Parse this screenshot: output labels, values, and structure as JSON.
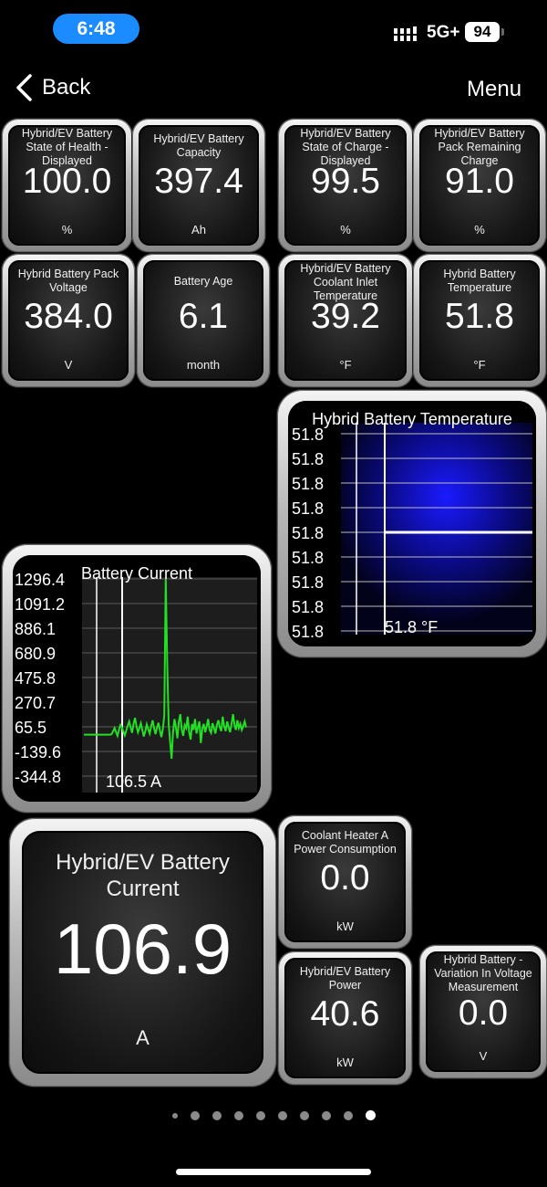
{
  "status_bar": {
    "time": "6:48",
    "network": "5G+",
    "battery": "94"
  },
  "nav": {
    "back_label": "Back",
    "menu_label": "Menu"
  },
  "gauges": [
    {
      "title": "Hybrid/EV Battery State of Health - Displayed",
      "value": "100.0",
      "unit": "%"
    },
    {
      "title": "Hybrid/EV Battery Capacity",
      "value": "397.4",
      "unit": "Ah"
    },
    {
      "title": "Hybrid/EV Battery State of Charge - Displayed",
      "value": "99.5",
      "unit": "%"
    },
    {
      "title": "Hybrid/EV Battery Pack Remaining Charge",
      "value": "91.0",
      "unit": "%"
    },
    {
      "title": "Hybrid Battery Pack Voltage",
      "value": "384.0",
      "unit": "V"
    },
    {
      "title": "Battery Age",
      "value": "6.1",
      "unit": "month"
    },
    {
      "title": "Hybrid/EV Battery Coolant Inlet Temperature",
      "value": "39.2",
      "unit": "°F"
    },
    {
      "title": "Hybrid Battery Temperature",
      "value": "51.8",
      "unit": "°F"
    },
    {
      "title": "Coolant Heater A Power Consumption",
      "value": "0.0",
      "unit": "kW"
    },
    {
      "title": "Hybrid/EV Battery Power",
      "value": "40.6",
      "unit": "kW"
    },
    {
      "title": "Hybrid Battery - Variation In Voltage Measurement",
      "value": "0.0",
      "unit": "V"
    }
  ],
  "big_gauge": {
    "title": "Hybrid/EV Battery Current",
    "value": "106.9",
    "unit": "A"
  },
  "temp_graph": {
    "title": "Hybrid Battery Temperature",
    "readout": "51.8 °F",
    "y_ticks": [
      "51.8",
      "51.8",
      "51.8",
      "51.8",
      "51.8",
      "51.8",
      "51.8",
      "51.8",
      "51.8"
    ]
  },
  "current_graph": {
    "title": "Battery Current",
    "readout": "106.5 A",
    "y_ticks": [
      "1296.4",
      "1091.2",
      "886.1",
      "680.9",
      "475.8",
      "270.7",
      "65.5",
      "-139.6",
      "-344.8"
    ]
  },
  "chart_data": [
    {
      "type": "line",
      "title": "Hybrid Battery Temperature",
      "series": [
        {
          "name": "Hybrid Battery Temperature",
          "values": [
            51.8,
            51.8,
            51.8,
            51.8,
            51.8,
            51.8,
            51.8,
            51.8
          ]
        }
      ],
      "unit": "°F",
      "color": "#ffffff"
    },
    {
      "type": "line",
      "title": "Battery Current",
      "ylim": [
        -344.8,
        1296.4
      ],
      "unit": "A",
      "color": "#22e022",
      "series": [
        {
          "name": "Battery Current",
          "values": [
            0,
            0,
            0,
            0,
            0,
            0,
            0,
            0,
            0,
            0,
            0,
            0,
            0,
            0,
            0,
            0,
            0,
            0,
            0,
            5,
            30,
            55,
            20,
            -10,
            40,
            80,
            60,
            25,
            -5,
            35,
            75,
            110,
            60,
            15,
            90,
            140,
            70,
            20,
            55,
            95,
            40,
            -15,
            30,
            85,
            45,
            10,
            70,
            120,
            55,
            5,
            60,
            100,
            35,
            -20,
            45,
            160,
            1296,
            600,
            90,
            -60,
            -200,
            20,
            130,
            60,
            -30,
            110,
            170,
            40,
            -10,
            80,
            55,
            150,
            20,
            -40,
            90,
            40,
            130,
            10,
            60,
            110,
            -70,
            50,
            90,
            20,
            70,
            130,
            40,
            15,
            95,
            55,
            10,
            80,
            120,
            60,
            30,
            150,
            70,
            30,
            110,
            60,
            20,
            90,
            170,
            80,
            40,
            120,
            55,
            90,
            40,
            70,
            110,
            60
          ]
        }
      ]
    }
  ]
}
